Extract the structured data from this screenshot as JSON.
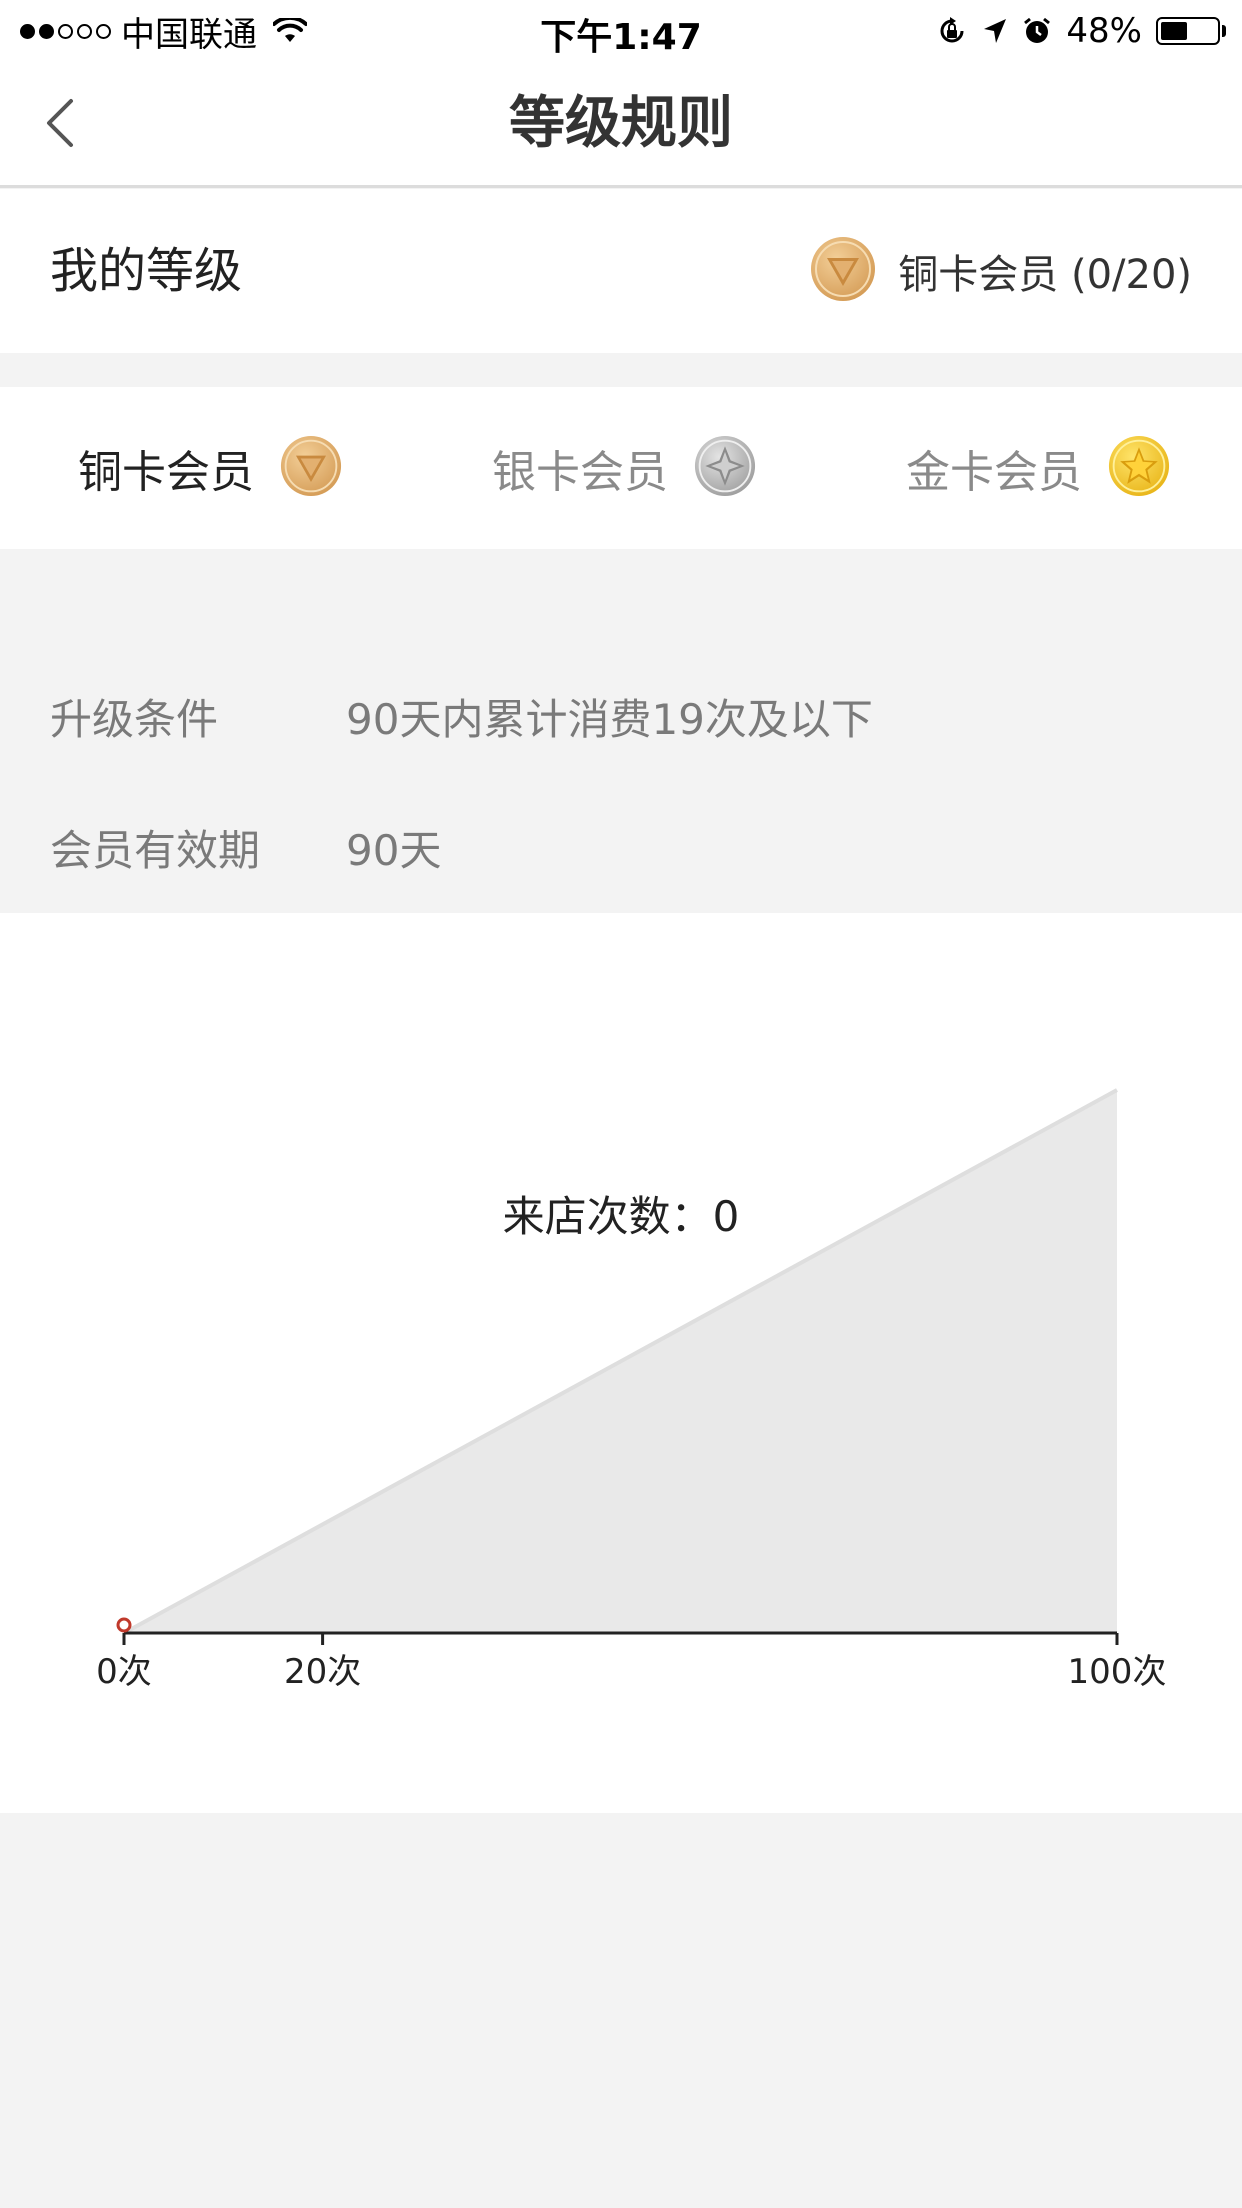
{
  "status_bar": {
    "carrier": "中国联通",
    "time": "下午1:47",
    "battery_percent": "48%",
    "battery_level": 0.48,
    "signal_bars": 2,
    "signal_total": 5
  },
  "nav": {
    "title": "等级规则",
    "back_icon": "chevron-left-icon"
  },
  "my_level": {
    "label": "我的等级",
    "value": "铜卡会员 (0/20)",
    "badge_icon": "bronze-medal-icon"
  },
  "tiers": [
    {
      "label": "铜卡会员",
      "icon": "bronze-medal-icon",
      "active": true
    },
    {
      "label": "银卡会员",
      "icon": "silver-medal-icon",
      "active": false
    },
    {
      "label": "金卡会员",
      "icon": "gold-medal-icon",
      "active": false
    }
  ],
  "info": {
    "upgrade_label": "升级条件",
    "upgrade_value": "90天内累计消费19次及以下",
    "validity_label": "会员有效期",
    "validity_value": "90天"
  },
  "chart_data": {
    "type": "area",
    "annotation": "来店次数：0",
    "current_value": 0,
    "tick_labels": [
      "0次",
      "20次",
      "100次"
    ],
    "tick_values": [
      0,
      20,
      100
    ],
    "x": [
      0,
      100
    ],
    "y": [
      0,
      100
    ],
    "colors": {
      "fill": "#e9e9e9",
      "edge": "#dedede",
      "axis": "#222222",
      "marker": "#c0392b"
    }
  }
}
